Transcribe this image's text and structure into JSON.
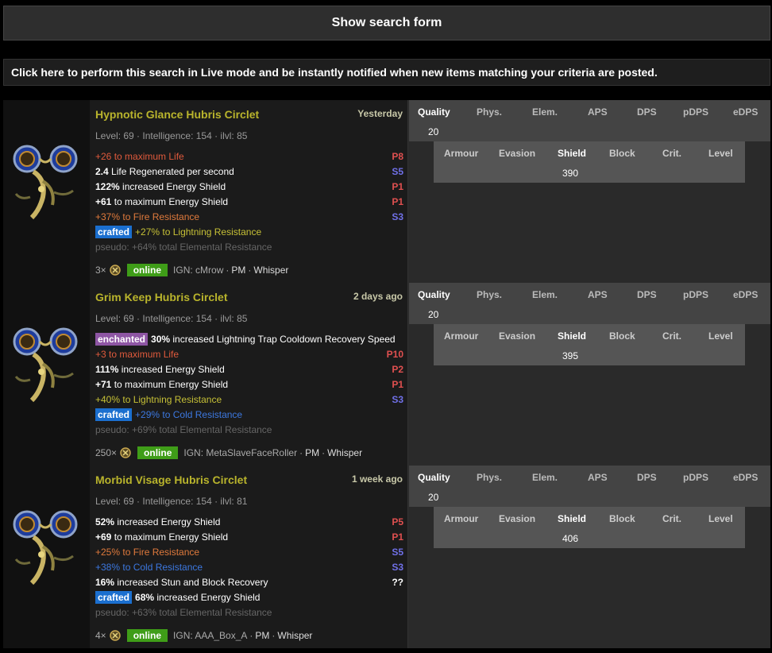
{
  "show_search_label": "Show search form",
  "live_mode_text": "Click here to perform this search in Live mode and be instantly notified when new items matching your criteria are posted.",
  "stat_headers": [
    "Quality",
    "Phys.",
    "Elem.",
    "APS",
    "DPS",
    "pDPS",
    "eDPS"
  ],
  "defence_headers": [
    "Armour",
    "Evasion",
    "Shield",
    "Block",
    "Crit.",
    "Level"
  ],
  "items": [
    {
      "name": "Hypnotic Glance Hubris Circlet",
      "age": "Yesterday",
      "reqs": "Level: 69 · Intelligence: 154 · ilvl: 85",
      "mods": [
        {
          "tag": "",
          "num": "+26",
          "text": " to maximum Life",
          "color": "life",
          "tier": "P8",
          "tier_type": "p"
        },
        {
          "tag": "",
          "num": "2.4",
          "text": " Life Regenerated per second",
          "color": "white",
          "tier": "S5",
          "tier_type": "s"
        },
        {
          "tag": "",
          "num": "122%",
          "text": " increased Energy Shield",
          "color": "white",
          "tier": "P1",
          "tier_type": "p"
        },
        {
          "tag": "",
          "num": "+61",
          "text": " to maximum Energy Shield",
          "color": "white",
          "tier": "P1",
          "tier_type": "p"
        },
        {
          "tag": "",
          "num": "+37%",
          "text": " to Fire Resistance",
          "color": "fire",
          "tier": "S3",
          "tier_type": "s"
        },
        {
          "tag": "crafted",
          "num": "+27%",
          "text": " to Lightning Resistance",
          "color": "light",
          "tier": "",
          "tier_type": ""
        },
        {
          "tag": "",
          "num": "pseudo: +64%",
          "text": " total Elemental Resistance",
          "color": "pseudo",
          "tier": "",
          "tier_type": ""
        }
      ],
      "stack": "3×",
      "status": "online",
      "ign": "IGN: cMrow",
      "pm": "PM",
      "whisper": "Whisper",
      "quality": "20",
      "shield": "390"
    },
    {
      "name": "Grim Keep Hubris Circlet",
      "age": "2 days ago",
      "reqs": "Level: 69 · Intelligence: 154 · ilvl: 85",
      "mods": [
        {
          "tag": "enchanted",
          "num": "30%",
          "text": " increased Lightning Trap Cooldown Recovery Speed",
          "color": "white",
          "tier": "",
          "tier_type": ""
        },
        {
          "tag": "",
          "num": "+3",
          "text": " to maximum Life",
          "color": "life",
          "tier": "P10",
          "tier_type": "p"
        },
        {
          "tag": "",
          "num": "111%",
          "text": " increased Energy Shield",
          "color": "white",
          "tier": "P2",
          "tier_type": "p"
        },
        {
          "tag": "",
          "num": "+71",
          "text": " to maximum Energy Shield",
          "color": "white",
          "tier": "P1",
          "tier_type": "p"
        },
        {
          "tag": "",
          "num": "+40%",
          "text": " to Lightning Resistance",
          "color": "light",
          "tier": "S3",
          "tier_type": "s"
        },
        {
          "tag": "crafted",
          "num": "+29%",
          "text": " to Cold Resistance",
          "color": "cold",
          "tier": "",
          "tier_type": ""
        },
        {
          "tag": "",
          "num": "pseudo: +69%",
          "text": " total Elemental Resistance",
          "color": "pseudo",
          "tier": "",
          "tier_type": ""
        }
      ],
      "stack": "250×",
      "status": "online",
      "ign": "IGN: MetaSlaveFaceRoller",
      "pm": "PM",
      "whisper": "Whisper",
      "quality": "20",
      "shield": "395"
    },
    {
      "name": "Morbid Visage Hubris Circlet",
      "age": "1 week ago",
      "reqs": "Level: 69 · Intelligence: 154 · ilvl: 81",
      "mods": [
        {
          "tag": "",
          "num": "52%",
          "text": " increased Energy Shield",
          "color": "white",
          "tier": "P5",
          "tier_type": "p"
        },
        {
          "tag": "",
          "num": "+69",
          "text": " to maximum Energy Shield",
          "color": "white",
          "tier": "P1",
          "tier_type": "p"
        },
        {
          "tag": "",
          "num": "+25%",
          "text": " to Fire Resistance",
          "color": "fire",
          "tier": "S5",
          "tier_type": "s"
        },
        {
          "tag": "",
          "num": "+38%",
          "text": " to Cold Resistance",
          "color": "cold",
          "tier": "S3",
          "tier_type": "s"
        },
        {
          "tag": "",
          "num": "16%",
          "text": " increased Stun and Block Recovery",
          "color": "white",
          "tier": "??",
          "tier_type": "q"
        },
        {
          "tag": "crafted",
          "num": "68%",
          "text": " increased Energy Shield",
          "color": "white",
          "tier": "",
          "tier_type": ""
        },
        {
          "tag": "",
          "num": "pseudo: +63%",
          "text": " total Elemental Resistance",
          "color": "pseudo",
          "tier": "",
          "tier_type": ""
        }
      ],
      "stack": "4×",
      "status": "online",
      "ign": "IGN: AAA_Box_A",
      "pm": "PM",
      "whisper": "Whisper",
      "quality": "20",
      "shield": "406"
    }
  ]
}
